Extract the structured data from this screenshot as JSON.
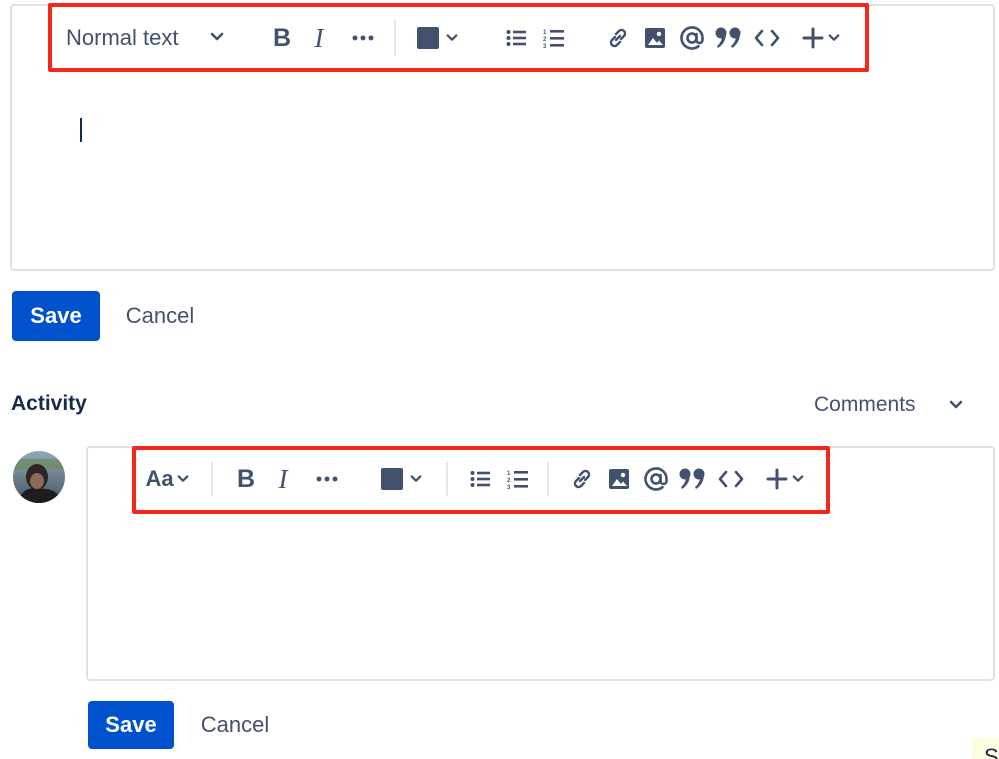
{
  "editor_top": {
    "toolbar": {
      "text_style": "Normal text"
    },
    "save_label": "Save",
    "cancel_label": "Cancel"
  },
  "activity": {
    "heading": "Activity",
    "filter_label": "Comments"
  },
  "editor_comment": {
    "toolbar": {
      "text_style": "Aa"
    },
    "save_label": "Save",
    "cancel_label": "Cancel"
  },
  "corner_note": {
    "text": "S"
  },
  "colors": {
    "primary": "#0052cc",
    "highlight": "#f5261a",
    "icon": "#42526e",
    "text": "#172b4d",
    "border": "#dfe1e6",
    "text_color_swatch": "#42526e"
  },
  "icons": [
    "chevron-down-icon",
    "bold-icon",
    "italic-icon",
    "more-formatting-icon",
    "text-color-icon",
    "bullet-list-icon",
    "numbered-list-icon",
    "link-icon",
    "image-icon",
    "mention-icon",
    "quote-icon",
    "code-icon",
    "plus-icon"
  ]
}
